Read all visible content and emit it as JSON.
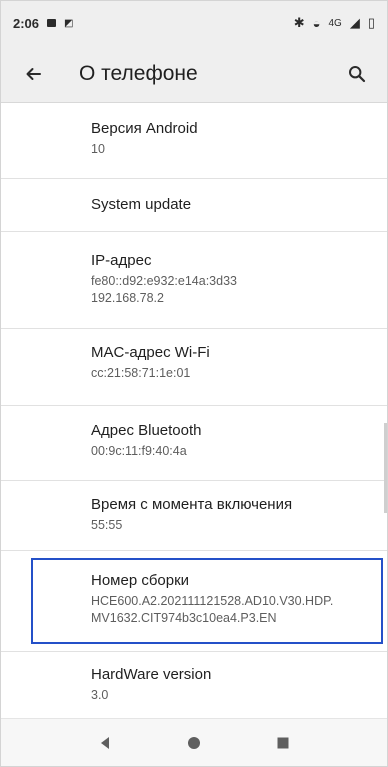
{
  "status_bar": {
    "time": "2:06",
    "right_text": "4G",
    "icons": [
      "notification-icon",
      "sim-icon",
      "bluetooth-icon",
      "wifi-icon",
      "signal-icon",
      "battery-icon"
    ]
  },
  "appbar": {
    "title": "О телефоне",
    "back_icon": "arrow-left-icon",
    "search_icon": "search-icon"
  },
  "items": [
    {
      "label": "Версия Android",
      "value": "10"
    },
    {
      "label": "System update",
      "value": ""
    },
    {
      "label": "IP-адрес",
      "value": "fe80::d92:e932:e14a:3d33\n192.168.78.2"
    },
    {
      "label": "MAC-адрес Wi-Fi",
      "value": "cc:21:58:71:1e:01"
    },
    {
      "label": "Адрес Bluetooth",
      "value": "00:9c:11:f9:40:4a"
    },
    {
      "label": "Время с момента включения",
      "value": "55:55"
    },
    {
      "label": "Номер сборки",
      "value": "HCE600.A2.202111121528.AD10.V30.HDP.\nMV1632.CIT974b3c10ea4.P3.EN"
    },
    {
      "label": "HardWare version",
      "value": "3.0"
    }
  ],
  "navbar": {
    "back_icon": "nav-back-icon",
    "home_icon": "nav-home-icon",
    "recents_icon": "nav-recents-icon"
  },
  "colors": {
    "highlight_border": "#2450c8",
    "appbar_bg": "#efefef"
  }
}
